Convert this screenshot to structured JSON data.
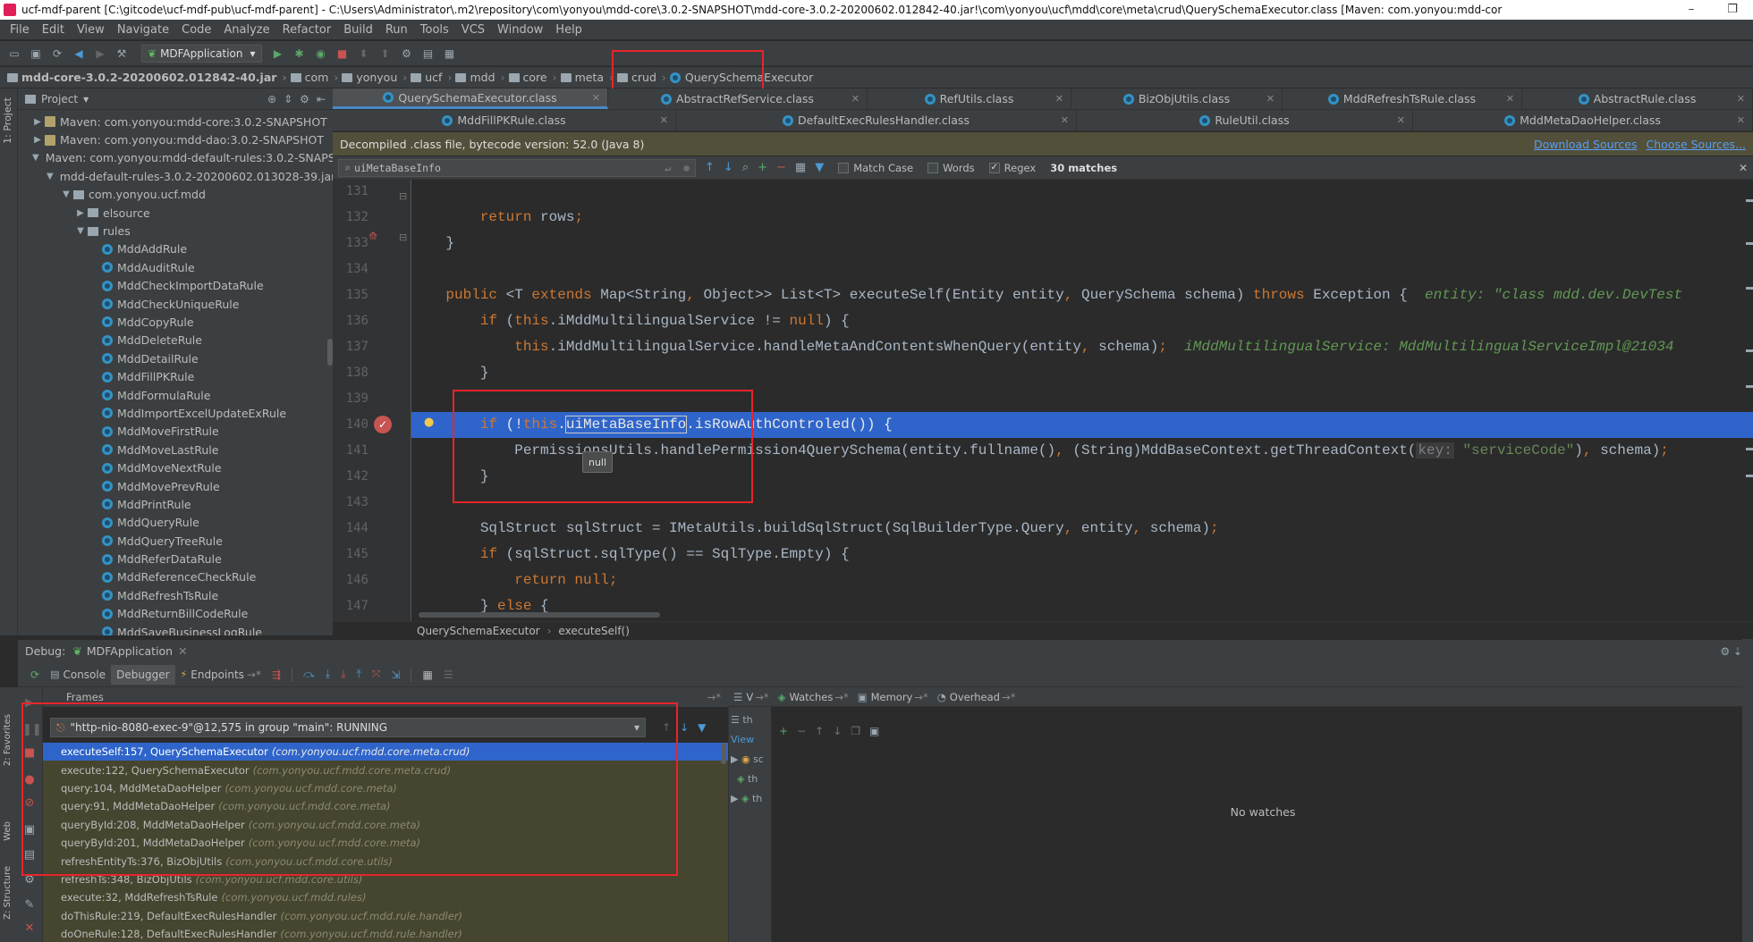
{
  "titlebar": {
    "text": "ucf-mdf-parent [C:\\gitcode\\ucf-mdf-pub\\ucf-mdf-parent] - C:\\Users\\Administrator\\.m2\\repository\\com\\yonyou\\mdd-core\\3.0.2-SNAPSHOT\\mdd-core-3.0.2-20200602.012842-40.jar!\\com\\yonyou\\ucf\\mdd\\core\\meta\\crud\\QuerySchemaExecutor.class [Maven: com.yonyou:mdd-cor",
    "minimize": "–",
    "maximize": "❐"
  },
  "menu": [
    "File",
    "Edit",
    "View",
    "Navigate",
    "Code",
    "Analyze",
    "Refactor",
    "Build",
    "Run",
    "Tools",
    "VCS",
    "Window",
    "Help"
  ],
  "toolbar": {
    "run_config": "MDFApplication"
  },
  "navbar": {
    "items": [
      "mdd-core-3.0.2-20200602.012842-40.jar",
      "com",
      "yonyou",
      "ucf",
      "mdd",
      "core",
      "meta",
      "crud"
    ],
    "current": "QuerySchemaExecutor"
  },
  "sidebar": {
    "project_tab": "1: Project",
    "favorites_tab": "2: Favorites",
    "web_tab": "Web",
    "structure_tab": "Z: Structure"
  },
  "project": {
    "header": "Project",
    "tree": [
      {
        "label": "Maven: com.yonyou:mdd-core:3.0.2-SNAPSHOT",
        "indent": 0,
        "type": "lib",
        "arrow": "▶"
      },
      {
        "label": "Maven: com.yonyou:mdd-dao:3.0.2-SNAPSHOT",
        "indent": 0,
        "type": "lib",
        "arrow": "▶"
      },
      {
        "label": "Maven: com.yonyou:mdd-default-rules:3.0.2-SNAPS",
        "indent": 0,
        "type": "lib",
        "arrow": "▼"
      },
      {
        "label": "mdd-default-rules-3.0.2-20200602.013028-39.jar",
        "indent": 1,
        "type": "lib",
        "arrow": "▼"
      },
      {
        "label": "com.yonyou.ucf.mdd",
        "indent": 2,
        "type": "pkg",
        "arrow": "▼"
      },
      {
        "label": "elsource",
        "indent": 3,
        "type": "pkg",
        "arrow": "▶"
      },
      {
        "label": "rules",
        "indent": 3,
        "type": "pkg",
        "arrow": "▼"
      },
      {
        "label": "MddAddRule",
        "indent": 4,
        "type": "cls",
        "arrow": ""
      },
      {
        "label": "MddAuditRule",
        "indent": 4,
        "type": "cls",
        "arrow": ""
      },
      {
        "label": "MddCheckImportDataRule",
        "indent": 4,
        "type": "cls",
        "arrow": ""
      },
      {
        "label": "MddCheckUniqueRule",
        "indent": 4,
        "type": "cls",
        "arrow": ""
      },
      {
        "label": "MddCopyRule",
        "indent": 4,
        "type": "cls",
        "arrow": ""
      },
      {
        "label": "MddDeleteRule",
        "indent": 4,
        "type": "cls",
        "arrow": ""
      },
      {
        "label": "MddDetailRule",
        "indent": 4,
        "type": "cls",
        "arrow": ""
      },
      {
        "label": "MddFillPKRule",
        "indent": 4,
        "type": "cls",
        "arrow": ""
      },
      {
        "label": "MddFormulaRule",
        "indent": 4,
        "type": "cls",
        "arrow": ""
      },
      {
        "label": "MddImportExcelUpdateExRule",
        "indent": 4,
        "type": "cls",
        "arrow": ""
      },
      {
        "label": "MddMoveFirstRule",
        "indent": 4,
        "type": "cls",
        "arrow": ""
      },
      {
        "label": "MddMoveLastRule",
        "indent": 4,
        "type": "cls",
        "arrow": ""
      },
      {
        "label": "MddMoveNextRule",
        "indent": 4,
        "type": "cls",
        "arrow": ""
      },
      {
        "label": "MddMovePrevRule",
        "indent": 4,
        "type": "cls",
        "arrow": ""
      },
      {
        "label": "MddPrintRule",
        "indent": 4,
        "type": "cls",
        "arrow": ""
      },
      {
        "label": "MddQueryRule",
        "indent": 4,
        "type": "cls",
        "arrow": ""
      },
      {
        "label": "MddQueryTreeRule",
        "indent": 4,
        "type": "cls",
        "arrow": ""
      },
      {
        "label": "MddReferDataRule",
        "indent": 4,
        "type": "cls",
        "arrow": ""
      },
      {
        "label": "MddReferenceCheckRule",
        "indent": 4,
        "type": "cls",
        "arrow": ""
      },
      {
        "label": "MddRefreshTsRule",
        "indent": 4,
        "type": "cls",
        "arrow": ""
      },
      {
        "label": "MddReturnBillCodeRule",
        "indent": 4,
        "type": "cls",
        "arrow": ""
      },
      {
        "label": "MddSaveBusinessLogRule",
        "indent": 4,
        "type": "cls",
        "arrow": ""
      }
    ]
  },
  "editor": {
    "tabs_row1": [
      "QuerySchemaExecutor.class",
      "AbstractRefService.class",
      "RefUtils.class",
      "BizObjUtils.class",
      "MddRefreshTsRule.class",
      "AbstractRule.class"
    ],
    "tabs_row2": [
      "MddFillPKRule.class",
      "DefaultExecRulesHandler.class",
      "RuleUtil.class",
      "MddMetaDaoHelper.class"
    ],
    "decompiled_notice": "Decompiled .class file, bytecode version: 52.0 (Java 8)",
    "download_sources": "Download Sources",
    "choose_sources": "Choose Sources...",
    "find": {
      "query": "uiMetaBaseInfo",
      "match_case": "Match Case",
      "words": "Words",
      "regex": "Regex",
      "regex_checked": true,
      "matches": "30 matches"
    },
    "line_numbers": [
      "131",
      "132",
      "133",
      "134",
      "135",
      "136",
      "137",
      "138",
      "139",
      "140",
      "141",
      "142",
      "143",
      "144",
      "145",
      "146",
      "147"
    ],
    "tooltip": "null",
    "breadcrumbs": [
      "QuerySchemaExecutor",
      "executeSelf()"
    ]
  },
  "debug": {
    "label": "Debug:",
    "config": "MDFApplication",
    "tabs": [
      "Console",
      "Debugger",
      "Endpoints"
    ],
    "frames_title": "Frames",
    "thread": "\"http-nio-8080-exec-9\"@12,575 in group \"main\": RUNNING",
    "frames": [
      {
        "method": "executeSelf:157, QuerySchemaExecutor",
        "pkg": "(com.yonyou.ucf.mdd.core.meta.crud)"
      },
      {
        "method": "execute:122, QuerySchemaExecutor",
        "pkg": "(com.yonyou.ucf.mdd.core.meta.crud)"
      },
      {
        "method": "query:104, MddMetaDaoHelper",
        "pkg": "(com.yonyou.ucf.mdd.core.meta)"
      },
      {
        "method": "query:91, MddMetaDaoHelper",
        "pkg": "(com.yonyou.ucf.mdd.core.meta)"
      },
      {
        "method": "queryById:208, MddMetaDaoHelper",
        "pkg": "(com.yonyou.ucf.mdd.core.meta)"
      },
      {
        "method": "queryById:201, MddMetaDaoHelper",
        "pkg": "(com.yonyou.ucf.mdd.core.meta)"
      },
      {
        "method": "refreshEntityTs:376, BizObjUtils",
        "pkg": "(com.yonyou.ucf.mdd.core.utils)"
      },
      {
        "method": "refreshTs:348, BizObjUtils",
        "pkg": "(com.yonyou.ucf.mdd.core.utils)"
      },
      {
        "method": "execute:32, MddRefreshTsRule",
        "pkg": "(com.yonyou.ucf.mdd.rules)"
      },
      {
        "method": "doThisRule:219, DefaultExecRulesHandler",
        "pkg": "(com.yonyou.ucf.mdd.rule.handler)"
      },
      {
        "method": "doOneRule:128, DefaultExecRulesHandler",
        "pkg": "(com.yonyou.ucf.mdd.rule.handler)"
      }
    ],
    "vars_tab": "V",
    "watches_tab": "Watches",
    "memory_tab": "Memory",
    "overhead_tab": "Overhead",
    "vars_items": [
      "View",
      "sc",
      "th",
      "th"
    ],
    "no_watches": "No watches"
  },
  "colors": {
    "annotation": "#e8242b",
    "selection": "#2f65ca",
    "keyword": "#cc7832"
  }
}
